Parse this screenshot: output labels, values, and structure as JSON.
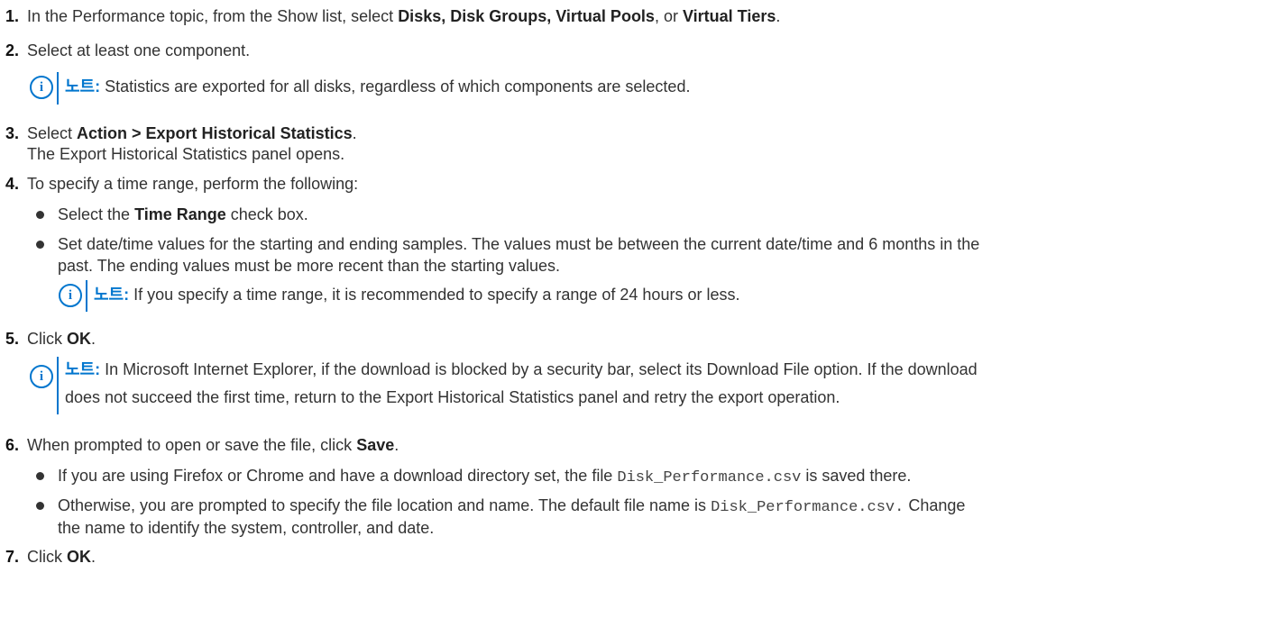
{
  "steps": [
    {
      "num": "1.",
      "t1": "In the Performance topic, from the Show list, select ",
      "b1": "Disks, Disk Groups, Virtual Pools",
      "t2": ", or ",
      "b2": "Virtual Tiers",
      "t3": "."
    },
    {
      "num": "2.",
      "text": "Select at least one component."
    },
    {
      "num": "3.",
      "t1": "Select ",
      "b1": "Action > Export Historical Statistics",
      "t2": ".",
      "sub": "The Export Historical Statistics panel opens."
    },
    {
      "num": "4.",
      "text": "To specify a time range, perform the following:"
    },
    {
      "num": "5.",
      "t1": "Click ",
      "b1": "OK",
      "t2": "."
    },
    {
      "num": "6.",
      "t1": "When prompted to open or save the file, click ",
      "b1": "Save",
      "t2": "."
    },
    {
      "num": "7.",
      "t1": "Click ",
      "b1": "OK",
      "t2": "."
    }
  ],
  "notes": {
    "label": "노트:",
    "icon": "info-icon",
    "note1": "Statistics are exported for all disks, regardless of which components are selected.",
    "note2": "If you specify a time range, it is recommended to specify a range of 24 hours or less.",
    "note3_l1": "In Microsoft Internet Explorer, if the download is blocked by a security bar, select its Download File option. If the download",
    "note3_l2": "does not succeed the first time, return to the Export Historical Statistics panel and retry the export operation."
  },
  "step4_bullets": {
    "b1_t1": "Select the ",
    "b1_b": "Time Range",
    "b1_t2": " check box.",
    "b2_l1": "Set date/time values for the starting and ending samples. The values must be between the current date/time and 6 months in the",
    "b2_l2": "past. The ending values must be more recent than the starting values."
  },
  "step6_bullets": {
    "b1_t1": "If you are using Firefox or Chrome and have a download directory set, the file ",
    "b1_code": "Disk_Performance.csv",
    "b1_t2": " is saved there.",
    "b2_t1": "Otherwise, you are prompted to specify the file location and name. The default file name is ",
    "b2_code": "Disk_Performance.csv.",
    "b2_t2": " Change",
    "b2_l2": "the name to identify the system, controller, and date."
  },
  "colors": {
    "accent": "#0076ce",
    "text": "#333333"
  }
}
